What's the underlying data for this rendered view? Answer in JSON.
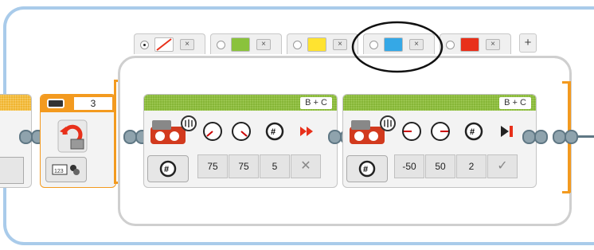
{
  "tabs": [
    {
      "name": "tab-no-color",
      "color": "none",
      "selected": true
    },
    {
      "name": "tab-green",
      "color": "#8ac23c",
      "selected": false
    },
    {
      "name": "tab-yellow",
      "color": "#ffe330",
      "selected": false
    },
    {
      "name": "tab-blue",
      "color": "#35a8e6",
      "selected": false
    },
    {
      "name": "tab-red",
      "color": "#e8301a",
      "selected": false
    }
  ],
  "tab_close": "×",
  "add_tab": "+",
  "switch": {
    "value": "3"
  },
  "blocks": [
    {
      "port": "B + C",
      "params": [
        "75",
        "75",
        "5"
      ],
      "end_mark": "✕"
    },
    {
      "port": "B + C",
      "params": [
        "-50",
        "50",
        "2"
      ],
      "end_mark": "✓"
    }
  ],
  "colors": {
    "frame": "#a9cbea",
    "orange": "#f39a1f",
    "green": "#86b637",
    "highlight": "#111111"
  }
}
